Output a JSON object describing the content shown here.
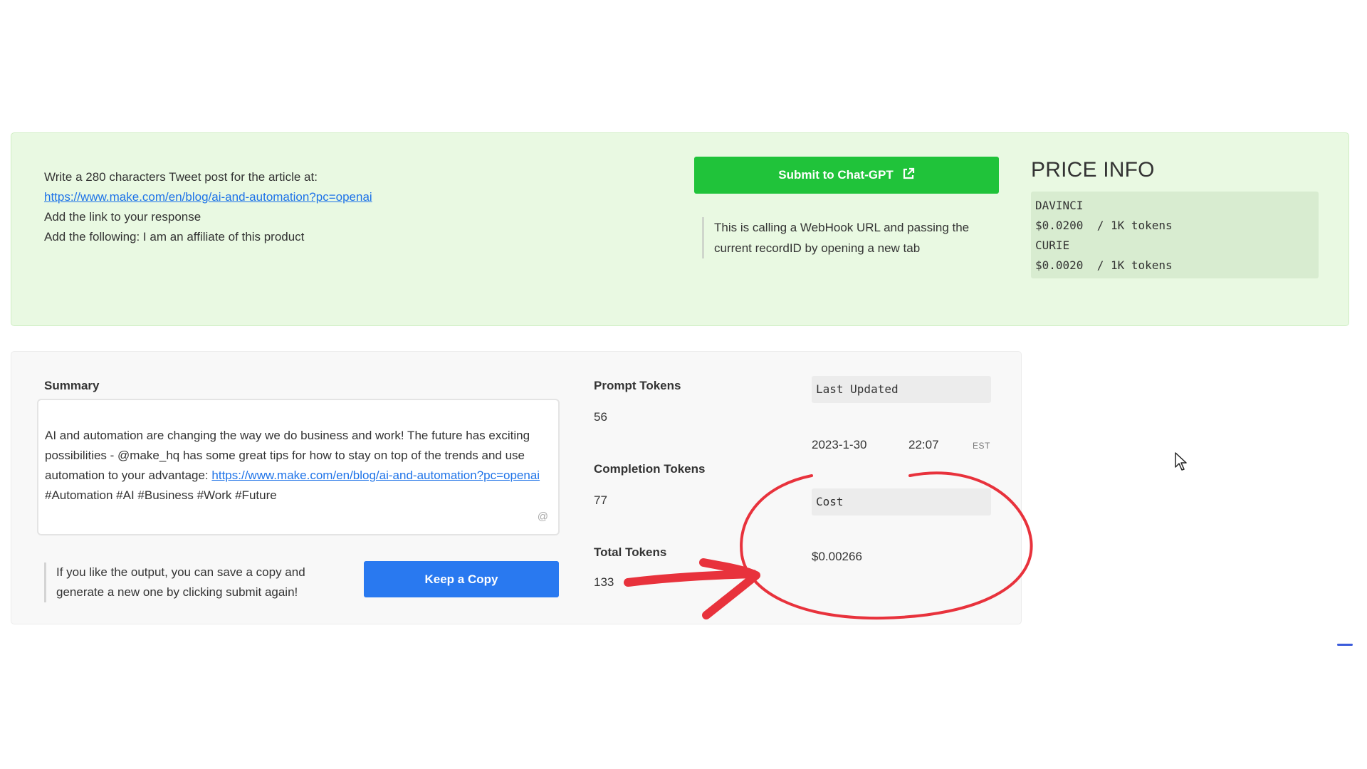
{
  "prompt": {
    "line1": "Write a 280 characters Tweet post for the article at:",
    "link": "https://www.make.com/en/blog/ai-and-automation?pc=openai",
    "line3": "Add the link to your response",
    "line4": "Add the following: I am an affiliate of this product"
  },
  "submit": {
    "label": "Submit to Chat-GPT",
    "icon": "external-link-icon",
    "note": "This is calling a WebHook URL and passing the current recordID  by opening a new tab"
  },
  "price_info": {
    "title": "PRICE INFO",
    "items": [
      {
        "model": "DAVINCI",
        "price": "$0.0200  / 1K tokens"
      },
      {
        "model": "CURIE",
        "price": "$0.0020  / 1K tokens"
      }
    ]
  },
  "summary": {
    "label": "Summary",
    "text_before": "AI and automation are changing the way we do business and work! The future has exciting possibilities - @make_hq has some great tips for how to stay on top of the trends and use automation to your advantage: ",
    "link": "https://www.make.com/en/blog/ai-and-automation?pc=openai",
    "text_after": " #Automation #AI #Business #Work #Future",
    "at_icon": "@"
  },
  "keep": {
    "note": "If you like the output, you can save a copy and generate a new one by clicking submit again!",
    "button_label": "Keep a Copy"
  },
  "tokens": {
    "prompt_label": "Prompt Tokens",
    "prompt_value": "56",
    "completion_label": "Completion Tokens",
    "completion_value": "77",
    "total_label": "Total Tokens",
    "total_value": "133"
  },
  "last_updated": {
    "label": "Last Updated",
    "date": "2023-1-30",
    "time": "22:07",
    "tz": "EST"
  },
  "cost": {
    "label": "Cost",
    "value": "$0.00266"
  },
  "colors": {
    "submit_green": "#20c33a",
    "keep_blue": "#2979f0",
    "annotation_red": "#e8323c",
    "panel_green": "#e9f9e2"
  }
}
